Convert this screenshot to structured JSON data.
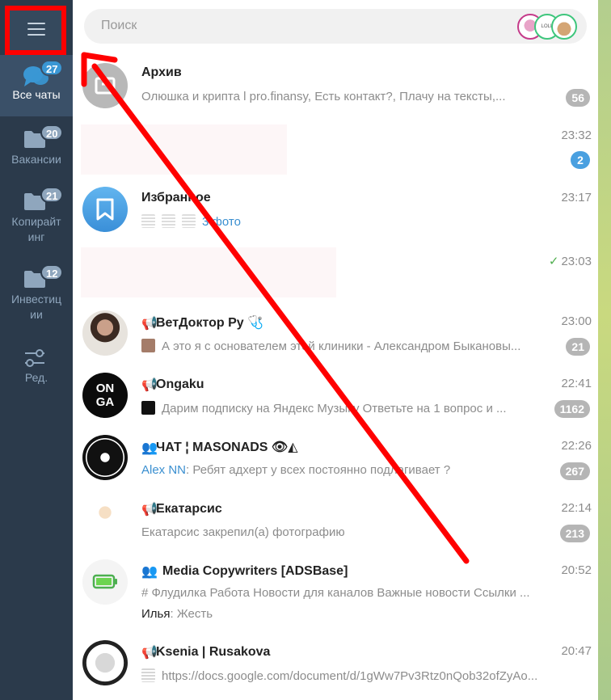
{
  "sidebar": {
    "folders": [
      {
        "label": "Все чаты",
        "badge": "27",
        "icon": "chats-icon"
      },
      {
        "label": "Вакансии",
        "badge": "20",
        "icon": "folder-icon"
      },
      {
        "label": "Копирайт инг",
        "badge": "21",
        "icon": "folder-icon"
      },
      {
        "label": "Инвестиц ии",
        "badge": "12",
        "icon": "folder-icon"
      },
      {
        "label": "Ред.",
        "badge": "",
        "icon": "sliders-icon"
      }
    ]
  },
  "search": {
    "placeholder": "Поиск",
    "story_label": "LOLL"
  },
  "chats": [
    {
      "name": "Архив",
      "time": "",
      "preview": "Олюшка и крипта l pro.finansy, Есть контакт?, Плачу на тексты,...",
      "count": "56"
    },
    {
      "name": "",
      "time": "23:32",
      "preview": "",
      "count": "2"
    },
    {
      "name": "Избранное",
      "time": "23:17",
      "preview": "3 фото",
      "count": ""
    },
    {
      "name": "",
      "time": "23:03",
      "preview": "",
      "count": ""
    },
    {
      "name": "ВетДоктор Ру 🩺",
      "time": "23:00",
      "preview": "А это я с основателем этой клиники - Александром Быкановы...",
      "count": "21"
    },
    {
      "name": "Ongaku",
      "time": "22:41",
      "preview": "Дарим подписку на Яндекс Музыку  Ответьте на 1 вопрос и ...",
      "count": "1162"
    },
    {
      "name": "ЧАТ ¦ MASONADS 👁◭",
      "time": "22:26",
      "preview_sender": "Alex NN",
      "preview": ": Ребят адхерт у всех постоянно подлагивает ?",
      "count": "267"
    },
    {
      "name": "Екатарсис",
      "time": "22:14",
      "preview": "Екатарсис закрепил(а) фотографию",
      "count": "213"
    },
    {
      "name": "Media Copywriters [ADSBase]",
      "time": "20:52",
      "preview": "# Флудилка  Работа  Новости для каналов  Важные новости  Ссылки ...",
      "preview_sender": "Илья",
      "preview2": ": Жесть",
      "count": ""
    },
    {
      "name": "Ksenia | Rusakova",
      "time": "20:47",
      "preview": "https://docs.google.com/document/d/1gWw7Pv3Rtz0nQob32ofZyAo...",
      "count": ""
    }
  ],
  "colors": {
    "accent": "#3a97d4",
    "sidebar": "#2b3a4b",
    "annotation": "#ff0000"
  }
}
